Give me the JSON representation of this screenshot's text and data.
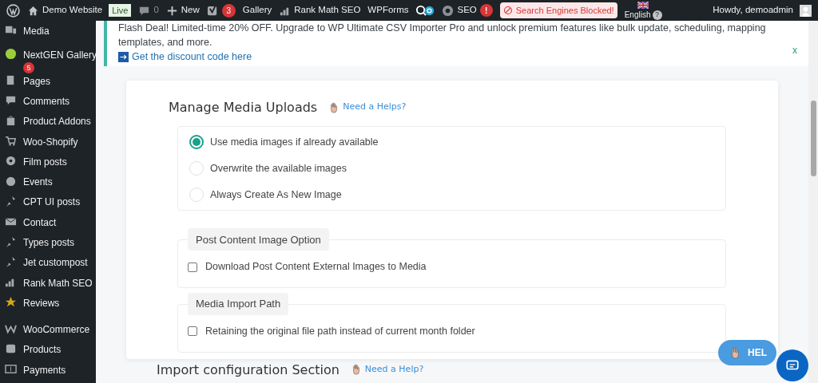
{
  "admin_bar": {
    "site": "Demo Website",
    "live": "Live",
    "comments": "0",
    "new": "New",
    "yoast_count": "3",
    "gallery": "Gallery",
    "rank_math": "Rank Math SEO",
    "wpforms": "WPForms",
    "seo": "SEO",
    "seo_alert": "!",
    "blocked": "Search Engines Blocked!",
    "language": "English",
    "language_help": "?",
    "howdy": "Howdy, demoadmin"
  },
  "sidebar": {
    "items": [
      {
        "label": "Media"
      },
      {
        "label": "NextGEN Gallery",
        "badge": "5"
      },
      {
        "label": "Pages"
      },
      {
        "label": "Comments"
      },
      {
        "label": "Product Addons"
      },
      {
        "label": "Woo-Shopify"
      },
      {
        "label": "Film posts"
      },
      {
        "label": "Events"
      },
      {
        "label": "CPT UI posts"
      },
      {
        "label": "Contact"
      },
      {
        "label": "Types posts"
      },
      {
        "label": "Jet custompost"
      },
      {
        "label": "Rank Math SEO"
      },
      {
        "label": "Reviews"
      },
      {
        "label": "WooCommerce"
      },
      {
        "label": "Products"
      },
      {
        "label": "Payments"
      }
    ]
  },
  "notice": {
    "text": "Flash Deal! Limited-time 20% OFF. Upgrade to WP Ultimate CSV Importer Pro and unlock premium features like bulk update, scheduling, mapping templates, and more.",
    "link": "Get the discount code here",
    "close": "x"
  },
  "media_uploads": {
    "title": "Manage Media Uploads",
    "help": "Need a Helps?",
    "options": [
      {
        "label": "Use media images if already available",
        "selected": true
      },
      {
        "label": "Overwrite the available images",
        "selected": false
      },
      {
        "label": "Always Create As New Image",
        "selected": false
      }
    ]
  },
  "groups": [
    {
      "legend": "Post Content Image Option",
      "option": "Download Post Content External Images to Media",
      "checked": false
    },
    {
      "legend": "Media Import Path",
      "option": "Retaining the original file path instead of current month folder",
      "checked": false
    }
  ],
  "import_config": {
    "title": "Import configuration Section",
    "help": "Need a Help?"
  },
  "help_button": "HEL"
}
